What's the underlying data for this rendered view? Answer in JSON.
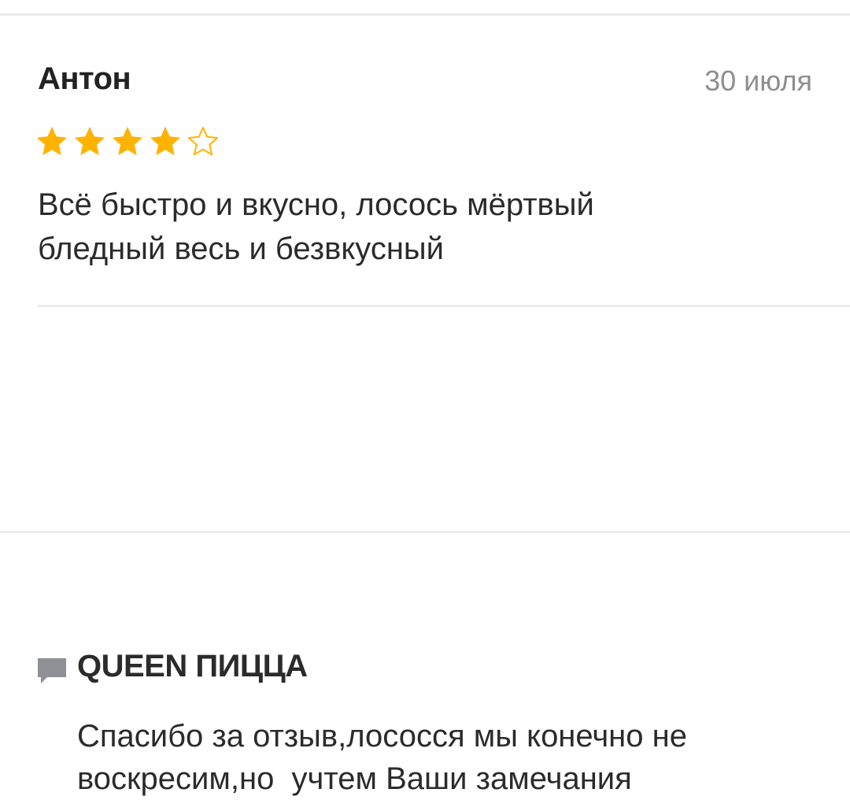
{
  "review": {
    "author": "Антон",
    "date": "30 июля",
    "rating": 4,
    "rating_max": 5,
    "text": "Всё быстро и вкусно, лосось мёртвый\nбледный весь и безвкусный",
    "star_color": "#ffb300"
  },
  "reply": {
    "icon": "comment-icon",
    "author": "QUEEN ПИЦЦА",
    "text": "Спасибо за отзыв,лососся мы конечно не\nвоскресим,но  учтем Ваши замечания"
  }
}
